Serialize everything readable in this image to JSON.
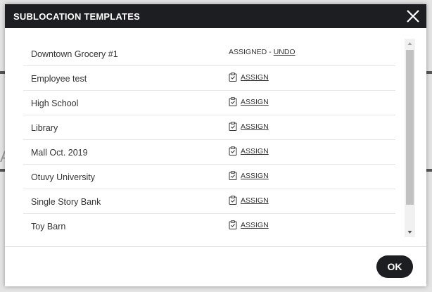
{
  "modal": {
    "title": "SUBLOCATION TEMPLATES",
    "ok_label": "OK"
  },
  "background": {
    "partial_glyph": "A"
  },
  "templates": [
    {
      "name": "Downtown Grocery #1",
      "status_text": "ASSIGNED - ",
      "action_label": "UNDO",
      "assigned": true
    },
    {
      "name": "Employee test",
      "status_text": "",
      "action_label": "ASSIGN",
      "assigned": false
    },
    {
      "name": "High School",
      "status_text": "",
      "action_label": "ASSIGN",
      "assigned": false
    },
    {
      "name": "Library",
      "status_text": "",
      "action_label": "ASSIGN",
      "assigned": false
    },
    {
      "name": "Mall Oct. 2019",
      "status_text": "",
      "action_label": "ASSIGN",
      "assigned": false
    },
    {
      "name": "Otuvy University",
      "status_text": "",
      "action_label": "ASSIGN",
      "assigned": false
    },
    {
      "name": "Single Story Bank",
      "status_text": "",
      "action_label": "ASSIGN",
      "assigned": false
    },
    {
      "name": "Toy Barn",
      "status_text": "",
      "action_label": "ASSIGN",
      "assigned": false
    }
  ],
  "colors": {
    "header_bg": "#1c1e21",
    "text": "#333333",
    "divider": "#e6e6e6"
  }
}
